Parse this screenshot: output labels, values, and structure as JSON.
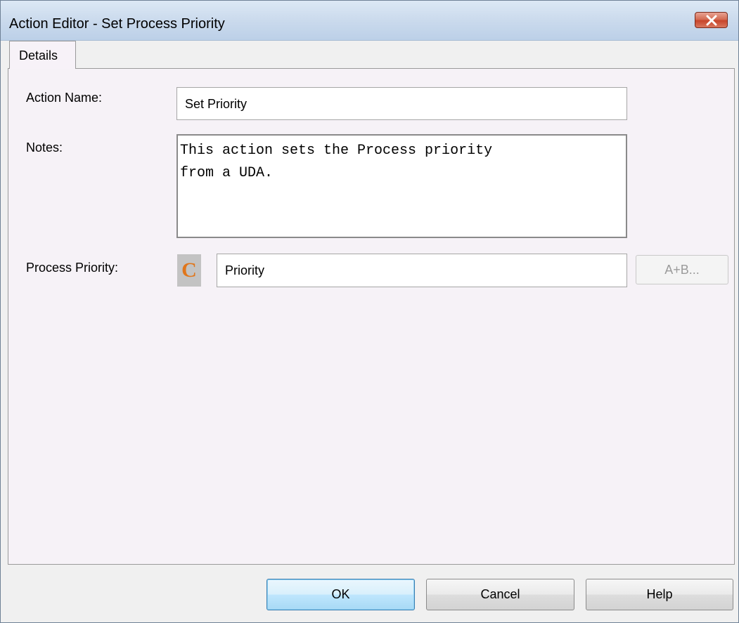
{
  "window": {
    "title": "Action Editor - Set Process Priority",
    "close_icon": "close-icon"
  },
  "tabs": [
    {
      "label": "Details",
      "active": true
    }
  ],
  "form": {
    "action_name_label": "Action Name:",
    "action_name_value": "Set Priority",
    "notes_label": "Notes:",
    "notes_value": "This action sets the Process priority\nfrom a UDA.",
    "process_priority_label": "Process Priority:",
    "process_priority_icon": "C",
    "process_priority_value": "Priority",
    "formula_button_label": "A+B..."
  },
  "buttons": {
    "ok": "OK",
    "cancel": "Cancel",
    "help": "Help"
  },
  "colors": {
    "constant_icon": "#e0761c",
    "close_button": "#c7452b"
  }
}
